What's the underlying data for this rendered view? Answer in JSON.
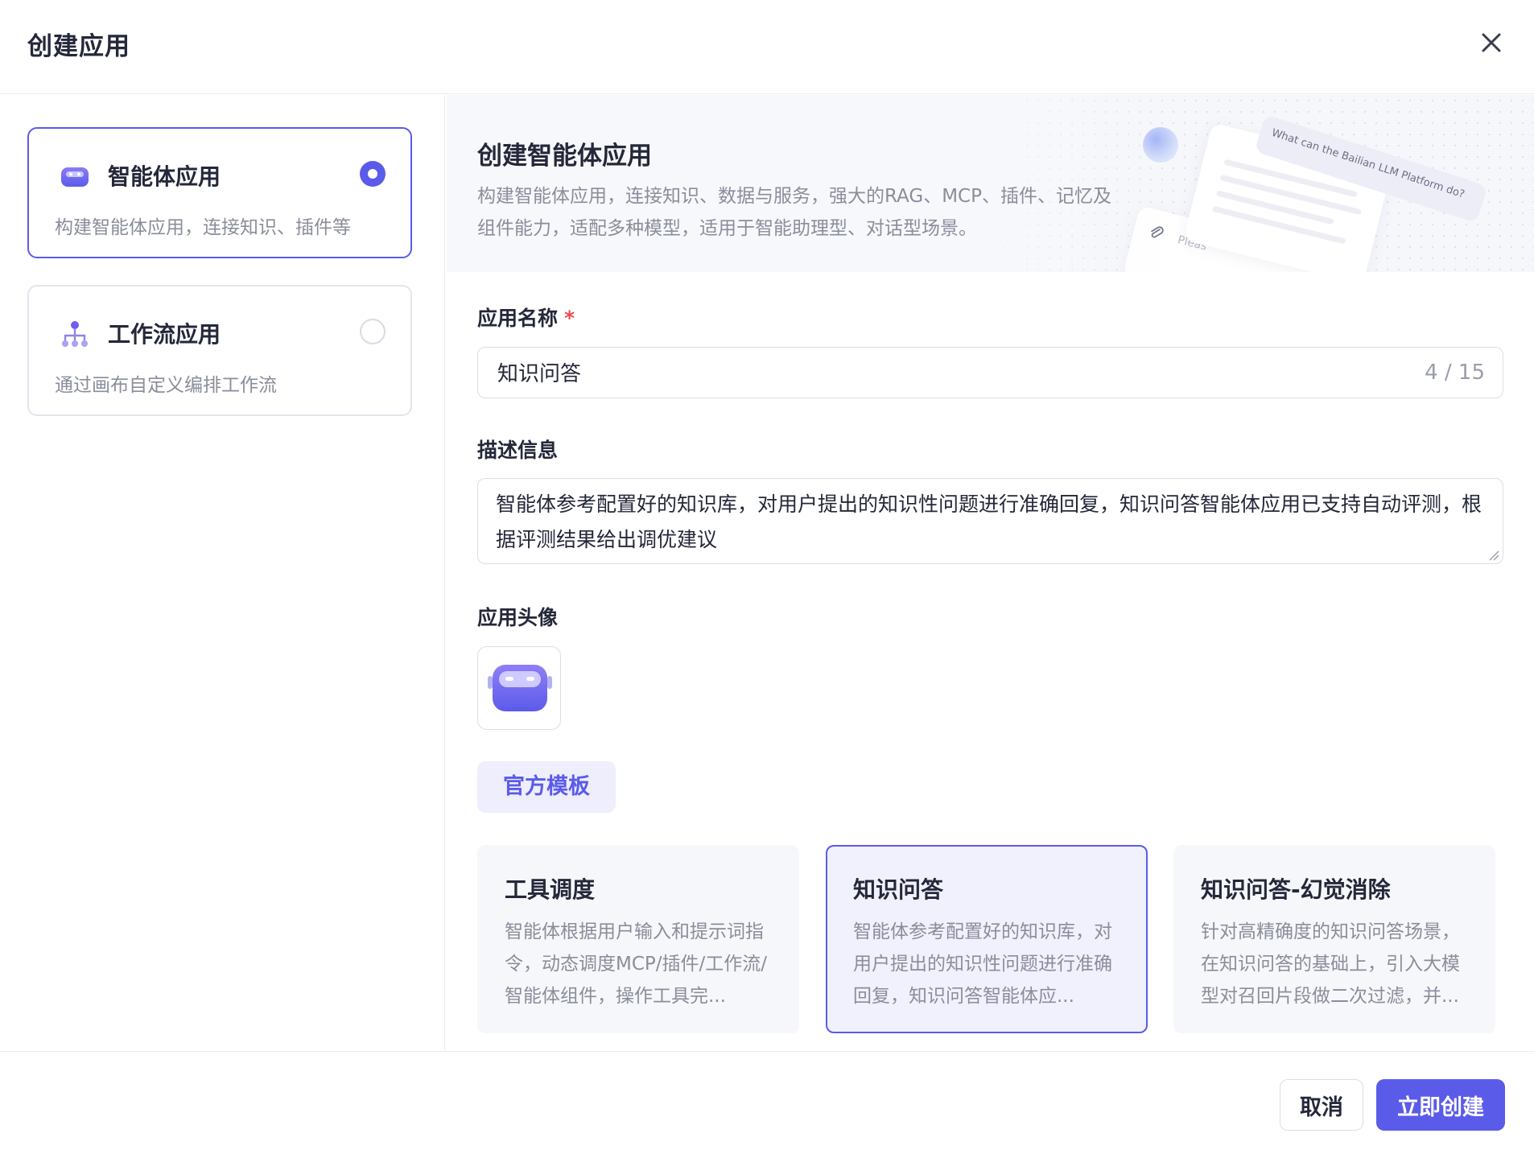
{
  "dialog": {
    "title": "创建应用"
  },
  "app_types": [
    {
      "title": "智能体应用",
      "desc": "构建智能体应用，连接知识、插件等",
      "selected": true
    },
    {
      "title": "工作流应用",
      "desc": "通过画布自定义编排工作流",
      "selected": false
    }
  ],
  "banner": {
    "title": "创建智能体应用",
    "desc": "构建智能体应用，连接知识、数据与服务，强大的RAG、MCP、插件、记忆及组件能力，适配多种模型，适用于智能助理型、对话型场景。",
    "art_bubble": "What can the Bailian LLM Platform do?",
    "art_input": "Pleas"
  },
  "form": {
    "name_label": "应用名称",
    "required_mark": "*",
    "name_value": "知识问答",
    "name_counter": "4 / 15",
    "desc_label": "描述信息",
    "desc_value": "智能体参考配置好的知识库，对用户提出的知识性问题进行准确回复，知识问答智能体应用已支持自动评测，根据评测结果给出调优建议",
    "avatar_label": "应用头像"
  },
  "templates": {
    "tab_label": "官方模板",
    "items": [
      {
        "title": "工具调度",
        "desc": "智能体根据用户输入和提示词指令，动态调度MCP/插件/工作流/智能体组件，操作工具完...",
        "selected": false
      },
      {
        "title": "知识问答",
        "desc": "智能体参考配置好的知识库，对用户提出的知识性问题进行准确回复，知识问答智能体应...",
        "selected": true
      },
      {
        "title": "知识问答-幻觉消除",
        "desc": "针对高精确度的知识问答场景，在知识问答的基础上，引入大模型对召回片段做二次过滤，并...",
        "selected": false
      }
    ]
  },
  "footer": {
    "cancel_label": "取消",
    "create_label": "立即创建"
  },
  "colors": {
    "accent": "#5b5bea",
    "accent_light": "#eeeefc",
    "required": "#f0494a"
  },
  "icons": {
    "close": "close-icon",
    "agent": "robot-icon",
    "workflow": "workflow-icon",
    "paperclip": "paperclip-icon"
  }
}
